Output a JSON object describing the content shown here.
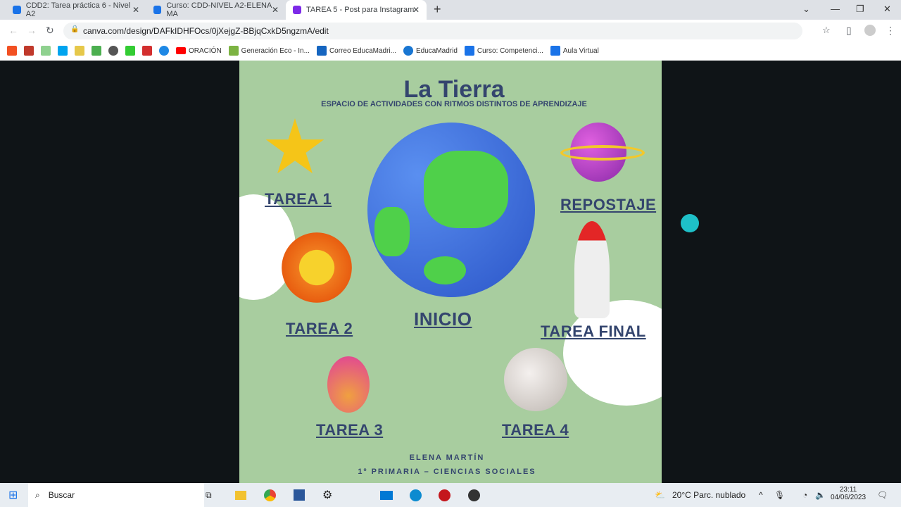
{
  "browser": {
    "tabs": [
      {
        "title": "CDD2: Tarea práctica 6 - Nivel A2"
      },
      {
        "title": "Curso: CDD-NIVEL A2-ELENA MA"
      },
      {
        "title": "TAREA 5 - Post para Instagram"
      }
    ],
    "url": "canva.com/design/DAFkIDHFOcs/0jXejgZ-BBjqCxkD5ngzmA/edit",
    "bookmarks": [
      "ORACIÓN",
      "Generación Eco - In...",
      "Correo EducaMadri...",
      "EducaMadrid",
      "Curso: Competenci...",
      "Aula Virtual"
    ]
  },
  "design": {
    "title": "La Tierra",
    "subtitle": "ESPACIO DE ACTIVIDADES CON RITMOS DISTINTOS DE APRENDIZAJE",
    "links": {
      "t1": "TAREA 1",
      "t2": "TAREA 2",
      "t3": "TAREA 3",
      "t4": "TAREA 4",
      "inicio": "INICIO",
      "repostaje": "REPOSTAJE",
      "final": "TAREA FINAL"
    },
    "author": "ELENA MARTÍN",
    "course": "1º PRIMARIA – CIENCIAS SOCIALES"
  },
  "taskbar": {
    "search": "Buscar",
    "weather": "20°C  Parc. nublado",
    "time": "23:11",
    "date": "04/06/2023"
  }
}
